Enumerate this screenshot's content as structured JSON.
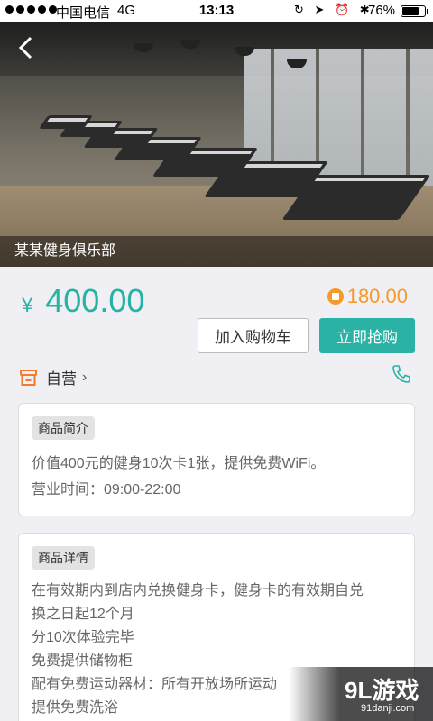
{
  "status_bar": {
    "carrier": "中国电信",
    "network": "4G",
    "time": "13:13",
    "battery": "76%",
    "battery_level": 0.76
  },
  "hero": {
    "caption": "某某健身俱乐部",
    "back_icon": "chevron-left-icon"
  },
  "price": {
    "currency": "¥",
    "value": "400.00"
  },
  "points": {
    "icon": "coin-icon",
    "value": "180.00"
  },
  "actions": {
    "add_to_cart": "加入购物车",
    "buy_now": "立即抢购"
  },
  "shop": {
    "label": "自营",
    "chevron": "›",
    "phone_icon": "phone-icon"
  },
  "intro": {
    "tag": "商品简介",
    "lines": [
      "价值400元的健身10次卡1张，提供免费WiFi。",
      "营业时间：09:00-22:00"
    ]
  },
  "details": {
    "tag": "商品详情",
    "lines": [
      "在有效期内到店内兑换健身卡，健身卡的有效期自兑",
      "换之日起12个月",
      "分10次体验完毕",
      "免费提供储物柜",
      "配有免费运动器材：所有开放场所运动",
      "提供免费洗浴"
    ]
  },
  "watermark": {
    "logo": "9L游戏",
    "site": "91danji.com"
  },
  "colors": {
    "accent": "#2ab3a4",
    "points": "#f39a2a",
    "background": "#efeff4"
  }
}
